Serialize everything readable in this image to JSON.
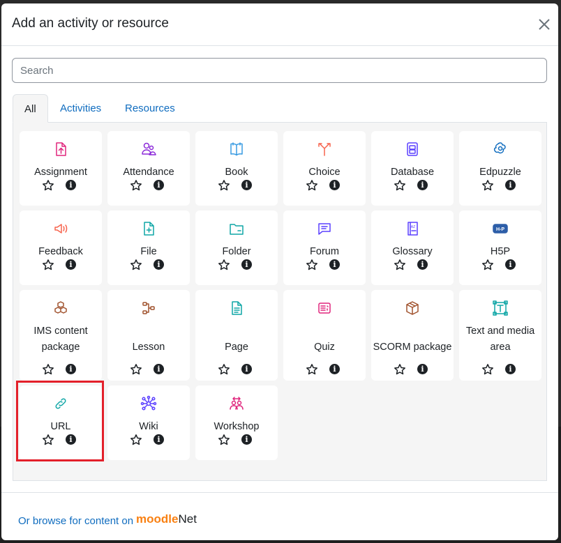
{
  "modal": {
    "title": "Add an activity or resource"
  },
  "search": {
    "placeholder": "Search"
  },
  "tabs": [
    {
      "label": "All"
    },
    {
      "label": "Activities"
    },
    {
      "label": "Resources"
    }
  ],
  "items": [
    {
      "label": "Assignment",
      "icon": "assignment-icon",
      "color": "#e0267d"
    },
    {
      "label": "Attendance",
      "icon": "attendance-icon",
      "color": "#8c2ad9"
    },
    {
      "label": "Book",
      "icon": "book-icon",
      "color": "#399be2"
    },
    {
      "label": "Choice",
      "icon": "choice-icon",
      "color": "#f7634d"
    },
    {
      "label": "Database",
      "icon": "database-icon",
      "color": "#5b40ff"
    },
    {
      "label": "Edpuzzle",
      "icon": "edpuzzle-icon",
      "color": "#0f6cbf"
    },
    {
      "label": "Feedback",
      "icon": "feedback-icon",
      "color": "#f7634d"
    },
    {
      "label": "File",
      "icon": "file-icon",
      "color": "#0fa6a6"
    },
    {
      "label": "Folder",
      "icon": "folder-icon",
      "color": "#0fa6a6"
    },
    {
      "label": "Forum",
      "icon": "forum-icon",
      "color": "#5b40ff"
    },
    {
      "label": "Glossary",
      "icon": "glossary-icon",
      "color": "#5b40ff"
    },
    {
      "label": "H5P",
      "icon": "h5p-icon",
      "color": "#2d5ea8"
    },
    {
      "label": "IMS content package",
      "icon": "ims-package-icon",
      "color": "#a0522d"
    },
    {
      "label": "Lesson",
      "icon": "lesson-icon",
      "color": "#a0522d"
    },
    {
      "label": "Page",
      "icon": "page-icon",
      "color": "#0fa6a6"
    },
    {
      "label": "Quiz",
      "icon": "quiz-icon",
      "color": "#e0267d"
    },
    {
      "label": "SCORM package",
      "icon": "scorm-icon",
      "color": "#a0522d"
    },
    {
      "label": "Text and media area",
      "icon": "text-media-icon",
      "color": "#0fa6a6"
    },
    {
      "label": "URL",
      "icon": "link-icon",
      "color": "#0fa6a6"
    },
    {
      "label": "Wiki",
      "icon": "wiki-icon",
      "color": "#5b40ff"
    },
    {
      "label": "Workshop",
      "icon": "workshop-icon",
      "color": "#e0267d"
    }
  ],
  "footer": {
    "link_text": "Or browse for content on",
    "brand_m": "m",
    "brand_oodle": "oodle",
    "brand_net": "Net"
  }
}
